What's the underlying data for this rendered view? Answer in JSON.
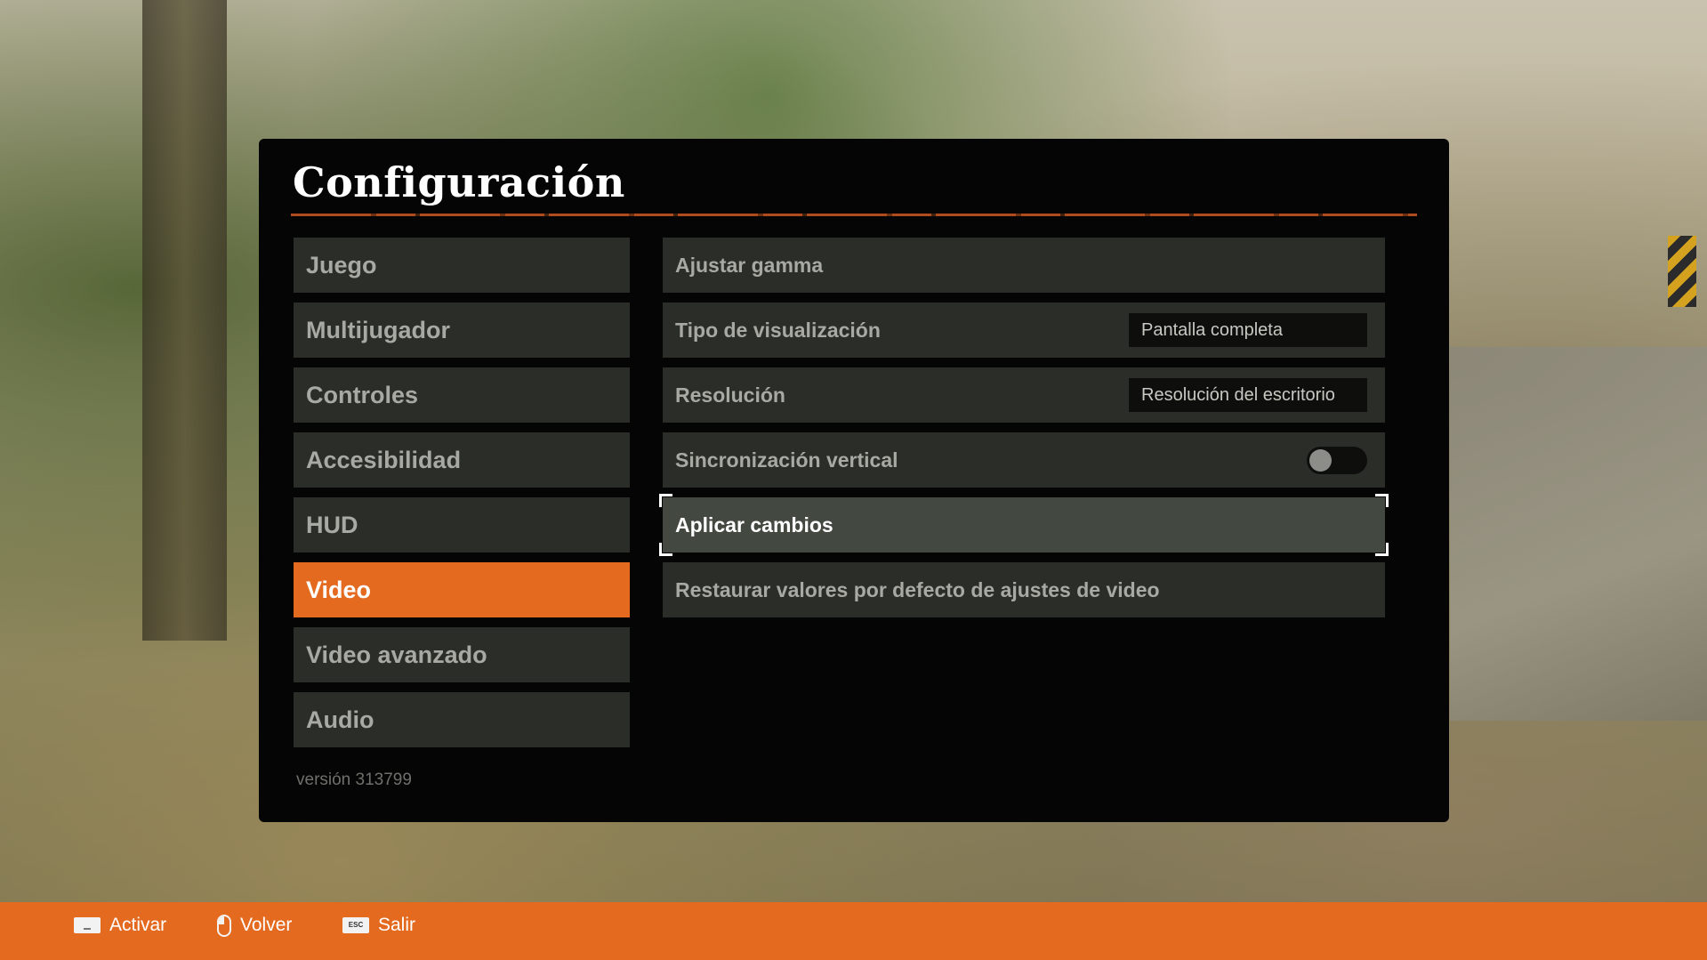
{
  "header": {
    "title": "Configuración"
  },
  "categories": [
    {
      "label": "Juego",
      "active": false
    },
    {
      "label": "Multijugador",
      "active": false
    },
    {
      "label": "Controles",
      "active": false
    },
    {
      "label": "Accesibilidad",
      "active": false
    },
    {
      "label": "HUD",
      "active": false
    },
    {
      "label": "Video",
      "active": true
    },
    {
      "label": "Video avanzado",
      "active": false
    },
    {
      "label": "Audio",
      "active": false
    }
  ],
  "options": {
    "gamma": {
      "label": "Ajustar gamma"
    },
    "display_type": {
      "label": "Tipo de visualización",
      "value": "Pantalla completa"
    },
    "resolution": {
      "label": "Resolución",
      "value": "Resolución del escritorio"
    },
    "vsync": {
      "label": "Sincronización vertical",
      "enabled": false
    },
    "apply": {
      "label": "Aplicar cambios",
      "focused": true
    },
    "restore": {
      "label": "Restaurar valores por defecto de ajustes de video"
    }
  },
  "version": "versión 313799",
  "footer": {
    "hints": [
      {
        "key": "space-key-icon",
        "label": "Activar"
      },
      {
        "key": "mouse-right-icon",
        "label": "Volver"
      },
      {
        "key": "esc-key-icon",
        "key_text": "ESC",
        "label": "Salir"
      }
    ]
  },
  "colors": {
    "accent": "#e46a20",
    "panel": "#050505",
    "item": "#2b2d28",
    "item_focused": "#434940"
  }
}
